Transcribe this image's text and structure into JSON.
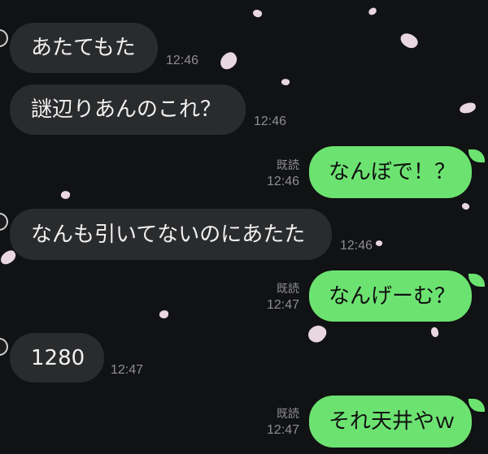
{
  "chat": {
    "colors": {
      "background": "#111213",
      "incoming_bubble": "#2a2b2d",
      "outgoing_bubble": "#6ce371",
      "meta_text": "#8e8e92",
      "petal": "#f6e3ea"
    },
    "messages": [
      {
        "direction": "in",
        "text": "あたてもた",
        "time": "12:46"
      },
      {
        "direction": "in",
        "text": "謎辺りあんのこれ？",
        "time": "12:46"
      },
      {
        "direction": "out",
        "text": "なんぼで！？",
        "time": "12:46",
        "read": "既読"
      },
      {
        "direction": "in",
        "text": "なんも引いてないのにあたた",
        "time": "12:46"
      },
      {
        "direction": "out",
        "text": "なんげーむ？",
        "time": "12:47",
        "read": "既読"
      },
      {
        "direction": "in",
        "text": "1280",
        "time": "12:47"
      },
      {
        "direction": "out",
        "text": "それ天井やｗ",
        "time": "12:47",
        "read": "既読"
      }
    ]
  }
}
